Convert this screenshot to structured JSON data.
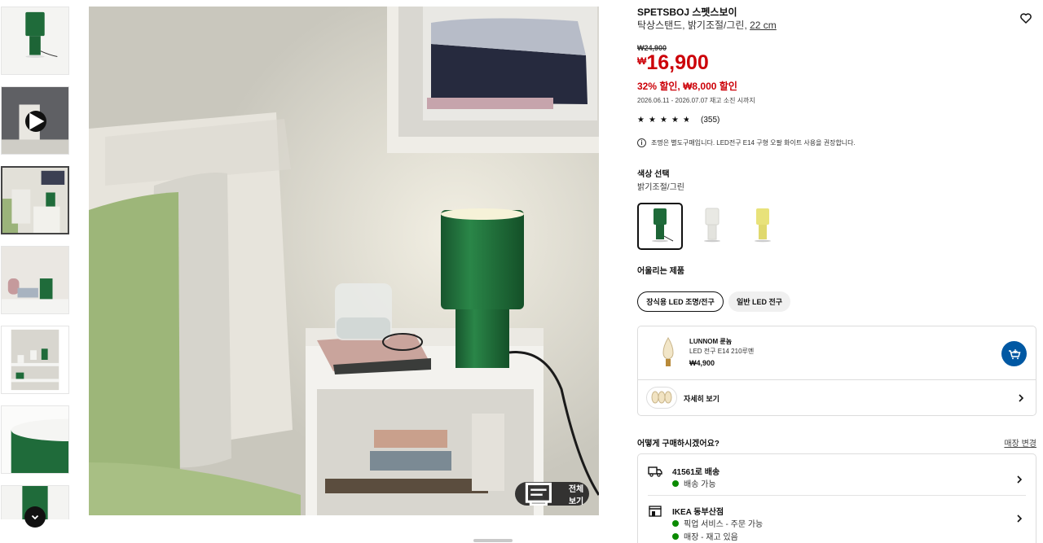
{
  "gallery": {
    "thumbnails": [
      "thumb-green-lamp",
      "thumb-video",
      "thumb-bedroom",
      "thumb-shelf",
      "thumb-stairs",
      "thumb-closeup",
      "thumb-detail"
    ],
    "view_all_label": "전체 보기"
  },
  "product": {
    "name": "SPETSBOJ 스펫스보이",
    "description": "탁상스탠드, 밝기조절/그린,",
    "size": "22 cm",
    "old_price": "₩24,900",
    "currency": "₩",
    "price": "16,900",
    "discount": "32% 할인, ₩8,000 할인",
    "sale_period": "2026.06.11 - 2026.07.07 재고 소진 시까지",
    "rating_stars": 4.5,
    "review_count": "(355)",
    "notice": "조명은 별도구매입니다. LED전구 E14 구형 오팔 화이트 사용을 권장합니다."
  },
  "colors": {
    "title": "색상 선택",
    "selected_label": "밝기조절/그린",
    "options": [
      {
        "name": "green",
        "hex": "#1f6b3a"
      },
      {
        "name": "white",
        "hex": "#e9e9e4"
      },
      {
        "name": "yellow",
        "hex": "#e8e27a"
      }
    ]
  },
  "matching": {
    "title": "어울리는 제품",
    "chips": [
      "장식용 LED 조명/전구",
      "일반 LED 전구"
    ],
    "related": {
      "name": "LUNNOM 룬놈",
      "desc": "LED 전구 E14 210루멘",
      "price": "₩4,900"
    },
    "more_label": "자세히 보기"
  },
  "purchase": {
    "title": "어떻게 구매하시겠어요?",
    "store_change": "매장 변경",
    "delivery_title": "41561로 배송",
    "delivery_status": "배송 가능",
    "store_title": "IKEA 동부산점",
    "store_pickup": "픽업 서비스 - 주문 가능",
    "store_stock": "매장 - 재고 있음"
  },
  "colors_ui": {
    "sale_red": "#cc0008",
    "ikea_blue": "#0058a3",
    "stock_green": "#0a8a00"
  }
}
